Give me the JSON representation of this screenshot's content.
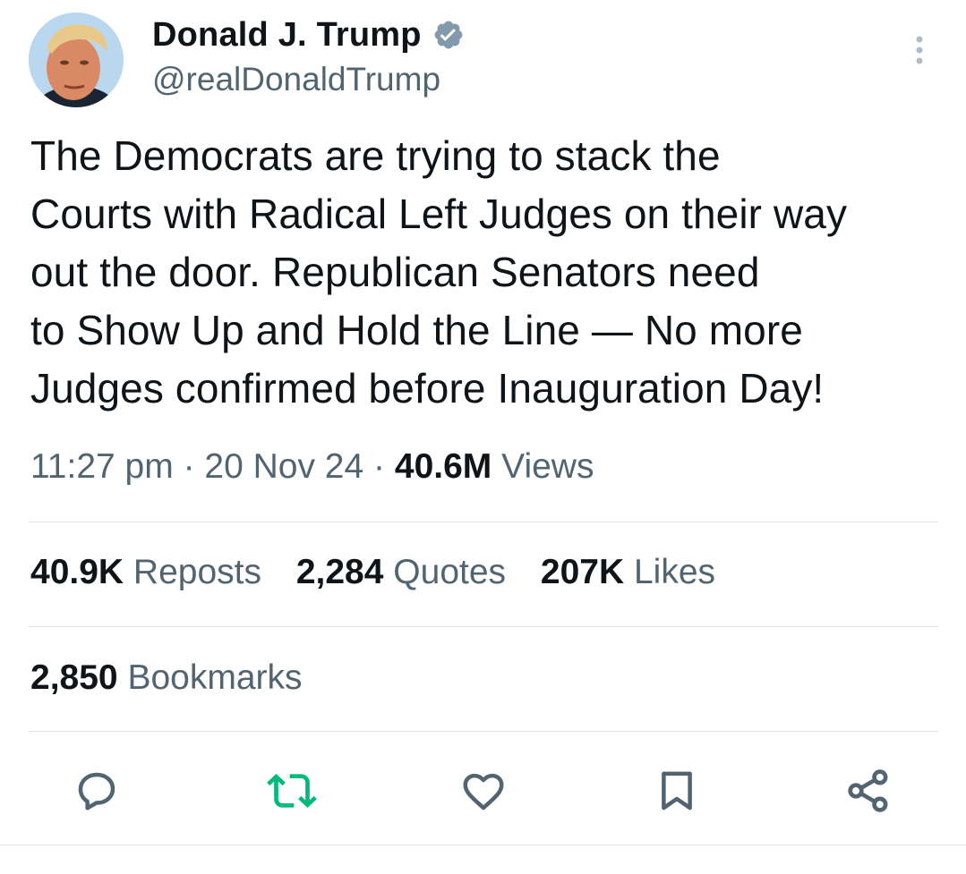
{
  "author": {
    "display_name": "Donald J. Trump",
    "handle": "@realDonaldTrump",
    "verified": true
  },
  "tweet": {
    "text": "The Democrats are trying to stack the\nCourts with Radical Left Judges on their way\nout the door. Republican Senators need\nto Show Up and Hold the Line — No more\nJudges confirmed before Inauguration Day!",
    "time": "11:27 pm",
    "separator": "·",
    "date": "20 Nov 24",
    "views_count": "40.6M",
    "views_label": "Views"
  },
  "stats": {
    "reposts_count": "40.9K",
    "reposts_label": "Reposts",
    "quotes_count": "2,284",
    "quotes_label": "Quotes",
    "likes_count": "207K",
    "likes_label": "Likes",
    "bookmarks_count": "2,850",
    "bookmarks_label": "Bookmarks"
  },
  "actions": {
    "reply_icon": "speech-bubble",
    "repost_icon": "repost-arrows",
    "like_icon": "heart",
    "bookmark_icon": "bookmark",
    "share_icon": "share-nodes"
  },
  "colors": {
    "text_primary": "#0f1419",
    "text_secondary": "#536471",
    "verified_badge": "#829aab",
    "repost_active": "#00ba7c",
    "divider": "#dde3e7"
  }
}
